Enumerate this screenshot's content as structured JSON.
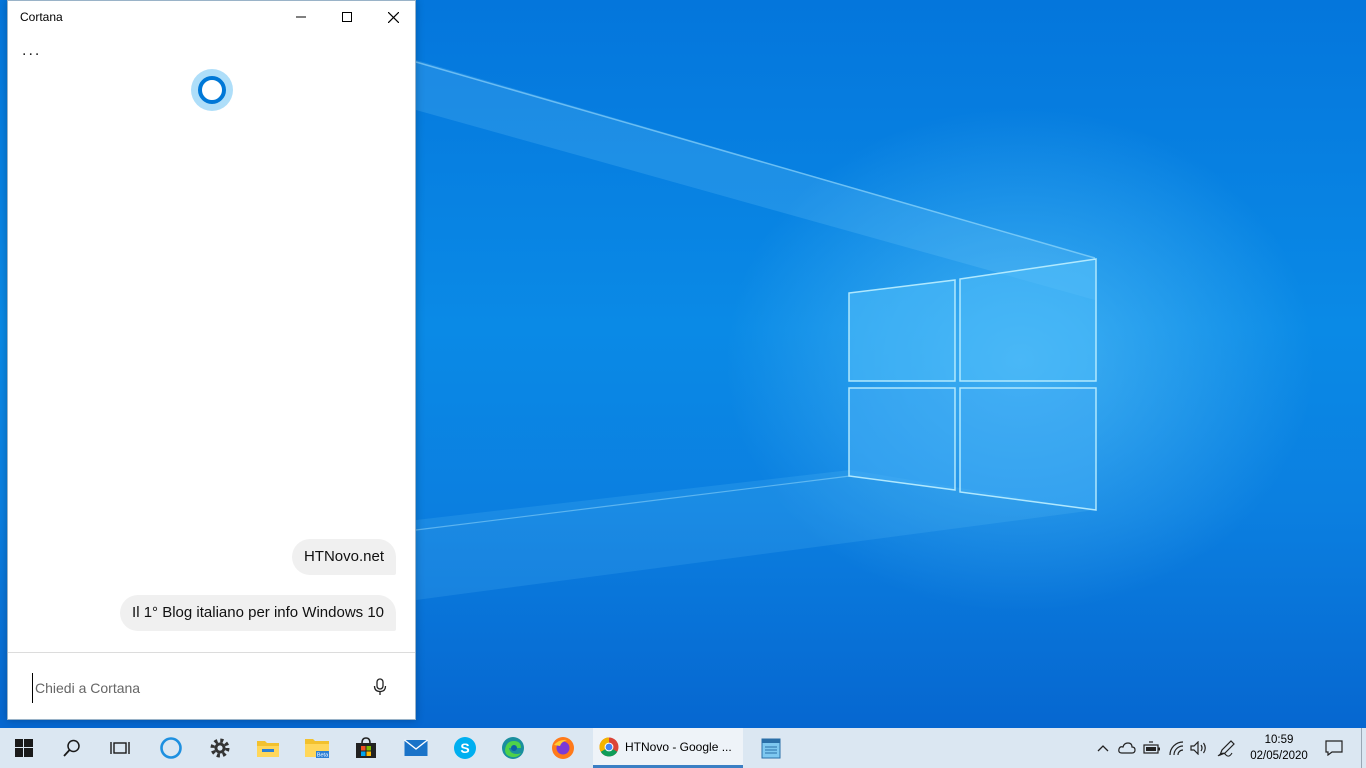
{
  "window": {
    "title": "Cortana",
    "more_label": "...",
    "messages": [
      "HTNovo.net",
      "Il 1° Blog italiano per info Windows 10"
    ],
    "input_placeholder": "Chiedi a Cortana",
    "accent_color": "#0078d7"
  },
  "taskbar": {
    "items": [
      {
        "name": "start",
        "icon": "windows-logo-icon"
      },
      {
        "name": "search",
        "icon": "search-icon"
      },
      {
        "name": "task-view",
        "icon": "task-view-icon"
      },
      {
        "name": "cortana",
        "icon": "cortana-icon"
      },
      {
        "name": "settings",
        "icon": "gear-icon"
      },
      {
        "name": "file-explorer",
        "icon": "folder-icon"
      },
      {
        "name": "file-explorer-beta",
        "icon": "folder-beta-icon",
        "badge": "Beta"
      },
      {
        "name": "store",
        "icon": "store-icon"
      },
      {
        "name": "mail",
        "icon": "mail-icon"
      },
      {
        "name": "skype",
        "icon": "skype-icon",
        "letter": "S"
      },
      {
        "name": "edge",
        "icon": "edge-icon"
      },
      {
        "name": "firefox",
        "icon": "firefox-icon"
      },
      {
        "name": "notepad",
        "icon": "notepad-icon"
      }
    ],
    "active_app_label": "HTNovo - Google ...",
    "clock_time": "10:59",
    "clock_date": "02/05/2020"
  }
}
